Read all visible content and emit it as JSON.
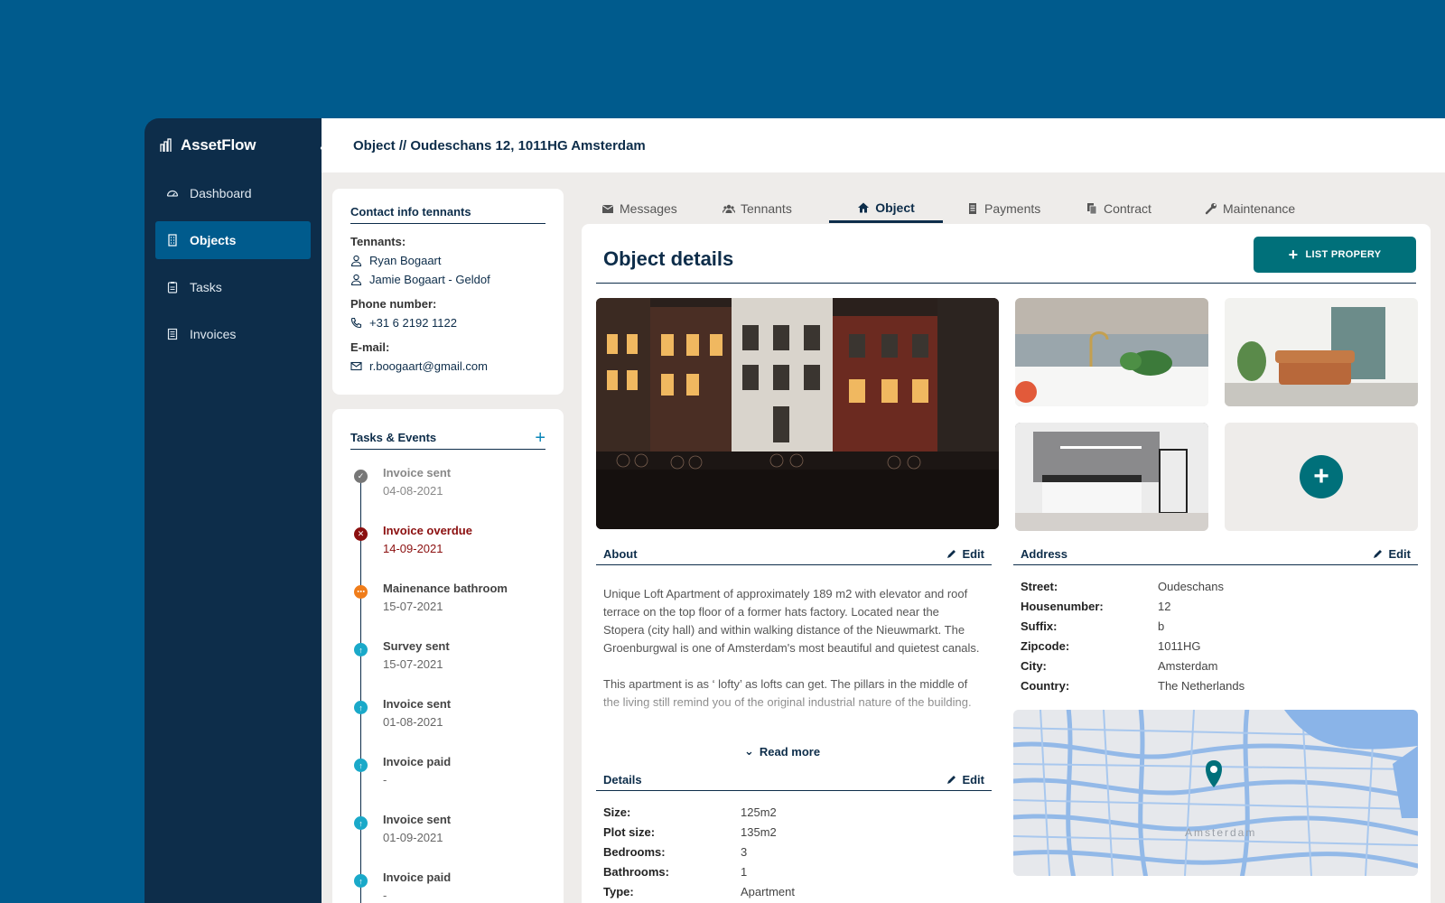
{
  "app": {
    "name": "AssetFlow"
  },
  "sidebar": {
    "items": [
      {
        "label": "Dashboard",
        "icon": "gauge-icon",
        "active": false
      },
      {
        "label": "Objects",
        "icon": "building-icon",
        "active": true
      },
      {
        "label": "Tasks",
        "icon": "clipboard-icon",
        "active": false
      },
      {
        "label": "Invoices",
        "icon": "invoice-icon",
        "active": false
      }
    ]
  },
  "header": {
    "breadcrumb": "Object // Oudeschans 12, 1011HG Amsterdam"
  },
  "contact": {
    "title": "Contact info tennants",
    "tenants_label": "Tennants:",
    "tenants": [
      "Ryan Bogaart",
      "Jamie Bogaart - Geldof"
    ],
    "phone_label": "Phone number:",
    "phone": "+31 6 2192 1122",
    "email_label": "E-mail:",
    "email": "r.boogaart@gmail.com"
  },
  "tasks": {
    "title": "Tasks & Events",
    "items": [
      {
        "title": "Invoice sent",
        "date": "04-08-2021",
        "status": "done"
      },
      {
        "title": "Invoice overdue",
        "date": "14-09-2021",
        "status": "overdue"
      },
      {
        "title": "Mainenance bathroom",
        "date": "15-07-2021",
        "status": "pending"
      },
      {
        "title": "Survey sent",
        "date": "15-07-2021",
        "status": "upcoming"
      },
      {
        "title": "Invoice sent",
        "date": "01-08-2021",
        "status": "upcoming"
      },
      {
        "title": "Invoice paid",
        "date": "-",
        "status": "upcoming"
      },
      {
        "title": "Invoice sent",
        "date": "01-09-2021",
        "status": "upcoming"
      },
      {
        "title": "Invoice paid",
        "date": "-",
        "status": "upcoming"
      }
    ]
  },
  "tabs": [
    {
      "label": "Messages",
      "icon": "envelope-icon",
      "active": false
    },
    {
      "label": "Tennants",
      "icon": "users-icon",
      "active": false
    },
    {
      "label": "Object",
      "icon": "home-icon",
      "active": true
    },
    {
      "label": "Payments",
      "icon": "receipt-icon",
      "active": false
    },
    {
      "label": "Contract",
      "icon": "documents-icon",
      "active": false
    },
    {
      "label": "Maintenance",
      "icon": "wrench-icon",
      "active": false
    }
  ],
  "details": {
    "title": "Object details",
    "list_button": "LIST PROPERY",
    "about": {
      "heading": "About",
      "edit": "Edit",
      "paragraphs": [
        "Unique Loft Apartment of approximately 189 m2 with elevator and roof terrace on the top floor of a former hats factory. Located near the Stopera (city hall) and within walking distance of the Nieuwmarkt. The Groenburgwal is one of Amsterdam's most beautiful and quietest canals.",
        "This apartment is as ‘ lofty’ as lofts can get. The pillars in the middle of the living still remind you of the original industrial nature of the building."
      ],
      "read_more": "Read more"
    },
    "address": {
      "heading": "Address",
      "edit": "Edit",
      "rows": [
        {
          "key": "Street:",
          "value": "Oudeschans"
        },
        {
          "key": "Housenumber:",
          "value": "12"
        },
        {
          "key": "Suffix:",
          "value": "b"
        },
        {
          "key": "Zipcode:",
          "value": "1011HG"
        },
        {
          "key": "City:",
          "value": "Amsterdam"
        },
        {
          "key": "Country:",
          "value": "The Netherlands"
        }
      ]
    },
    "specs": {
      "heading": "Details",
      "edit": "Edit",
      "rows": [
        {
          "key": "Size:",
          "value": "125m2"
        },
        {
          "key": "Plot size:",
          "value": "135m2"
        },
        {
          "key": "Bedrooms:",
          "value": "3"
        },
        {
          "key": "Bathrooms:",
          "value": "1"
        },
        {
          "key": "Type:",
          "value": "Apartment"
        }
      ]
    },
    "map": {
      "label": "Amsterdam"
    }
  },
  "colors": {
    "background": "#005b8d",
    "sidebar": "#0d2d4a",
    "accent": "#00707a",
    "overdue": "#8b0f0f",
    "pending": "#f07d1a",
    "upcoming": "#1aa9c9",
    "done": "#777777"
  }
}
